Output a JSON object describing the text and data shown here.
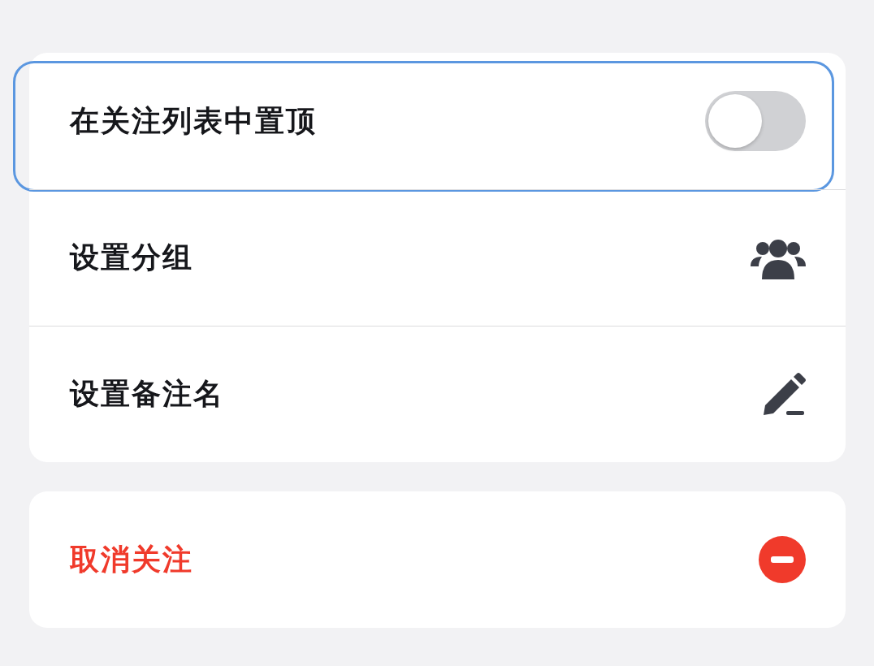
{
  "groups": [
    {
      "items": [
        {
          "kind": "toggle",
          "label": "在关注列表中置顶",
          "on": false,
          "focused": true
        },
        {
          "kind": "group",
          "label": "设置分组",
          "focused": false
        },
        {
          "kind": "edit",
          "label": "设置备注名",
          "focused": false
        }
      ]
    },
    {
      "items": [
        {
          "kind": "unfollow",
          "label": "取消关注",
          "focused": false
        }
      ]
    }
  ]
}
